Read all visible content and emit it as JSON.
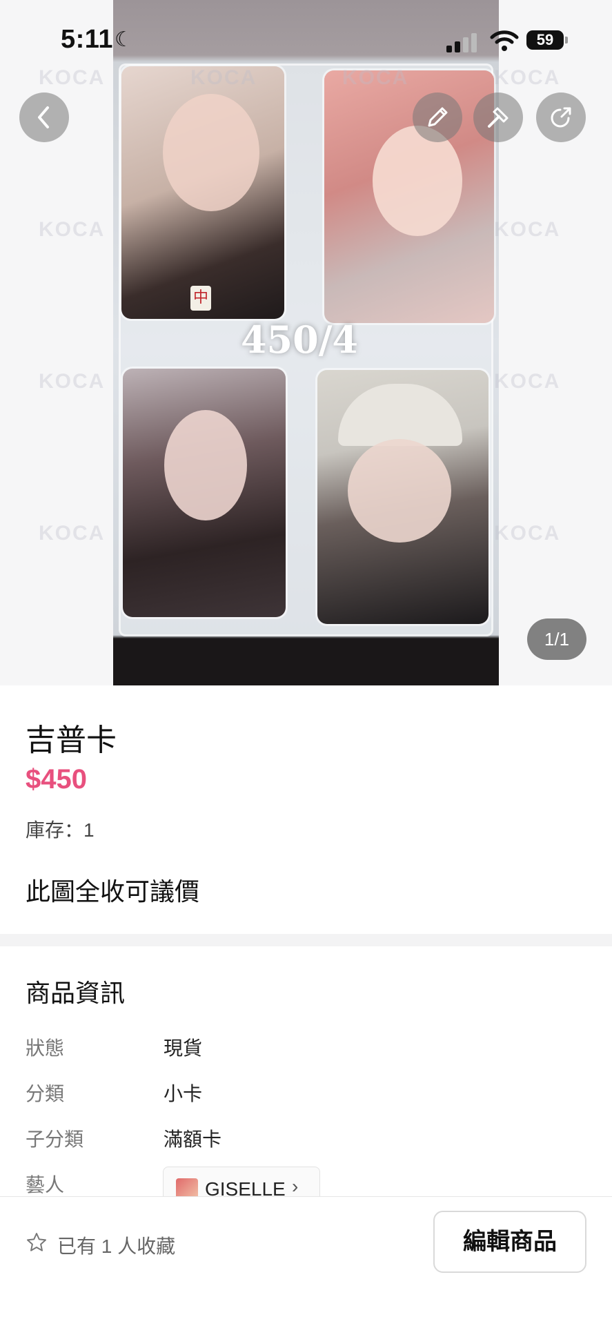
{
  "status_bar": {
    "time": "5:11",
    "battery": "59"
  },
  "image_viewer": {
    "price_overlay": "450/4",
    "counter": "1/1",
    "mahjong_tile": "中"
  },
  "product": {
    "title": "吉普卡",
    "price": "$450",
    "stock": "庫存：1",
    "note": "此圖全收可議價"
  },
  "info": {
    "section_title": "商品資訊",
    "rows": [
      {
        "key": "狀態",
        "value": "現貨"
      },
      {
        "key": "分類",
        "value": "小卡"
      },
      {
        "key": "子分類",
        "value": "滿額卡"
      },
      {
        "key": "藝人",
        "value": ""
      }
    ],
    "artist": "GISELLE"
  },
  "bottom_bar": {
    "favorite_text": "已有 1 人收藏",
    "edit_label": "編輯商品"
  },
  "watermark": "KOCA",
  "colors": {
    "price": "#e8507e",
    "overlay_button": "#7a7a7a"
  }
}
